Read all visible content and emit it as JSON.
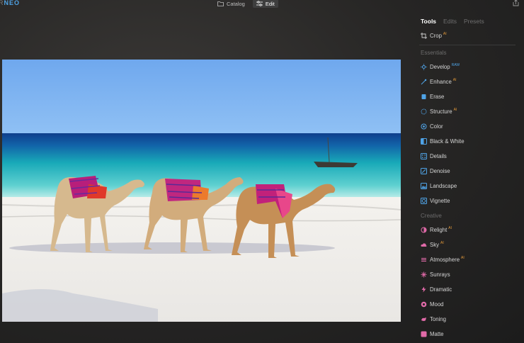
{
  "app": {
    "logo_prefix": "R",
    "logo_suffix": "NEO"
  },
  "topbar": {
    "modes": [
      {
        "label": "Catalog",
        "icon": "folder-icon",
        "active": false
      },
      {
        "label": "Edit",
        "icon": "sliders-icon",
        "active": true
      }
    ],
    "share_icon": "share-icon"
  },
  "panel": {
    "tabs": [
      {
        "label": "Tools",
        "active": true
      },
      {
        "label": "Edits",
        "active": false
      },
      {
        "label": "Presets",
        "active": false
      }
    ],
    "crop": {
      "label": "Crop",
      "mark": "AI"
    },
    "sections": {
      "essentials": "Essentials",
      "creative": "Creative"
    },
    "essentials_tools": [
      {
        "label": "Develop",
        "mark": "RAW",
        "mark_color": "blue",
        "icon": "develop-icon"
      },
      {
        "label": "Enhance",
        "mark": "AI",
        "mark_color": "orange",
        "icon": "enhance-icon"
      },
      {
        "label": "Erase",
        "mark": "",
        "icon": "eraser-icon"
      },
      {
        "label": "Structure",
        "mark": "AI",
        "mark_color": "orange",
        "icon": "structure-icon"
      },
      {
        "label": "Color",
        "mark": "",
        "icon": "color-icon"
      },
      {
        "label": "Black & White",
        "mark": "",
        "icon": "black-white-icon"
      },
      {
        "label": "Details",
        "mark": "",
        "icon": "details-icon"
      },
      {
        "label": "Denoise",
        "mark": "",
        "icon": "denoise-icon"
      },
      {
        "label": "Landscape",
        "mark": "",
        "icon": "landscape-icon"
      },
      {
        "label": "Vignette",
        "mark": "",
        "icon": "vignette-icon"
      }
    ],
    "creative_tools": [
      {
        "label": "Relight",
        "mark": "AI",
        "mark_color": "orange",
        "icon": "relight-icon"
      },
      {
        "label": "Sky",
        "mark": "AI",
        "mark_color": "orange",
        "icon": "sky-icon"
      },
      {
        "label": "Atmosphere",
        "mark": "AI",
        "mark_color": "orange",
        "icon": "atmosphere-icon"
      },
      {
        "label": "Sunrays",
        "mark": "",
        "icon": "sunrays-icon"
      },
      {
        "label": "Dramatic",
        "mark": "",
        "icon": "dramatic-icon"
      },
      {
        "label": "Mood",
        "mark": "",
        "icon": "mood-icon"
      },
      {
        "label": "Toning",
        "mark": "",
        "icon": "toning-icon"
      },
      {
        "label": "Matte",
        "mark": "",
        "icon": "matte-icon"
      }
    ]
  },
  "colors": {
    "accent_blue": "#4fa3e6",
    "ai_orange": "#e49a3a",
    "panel_text": "#d4d4d4"
  }
}
